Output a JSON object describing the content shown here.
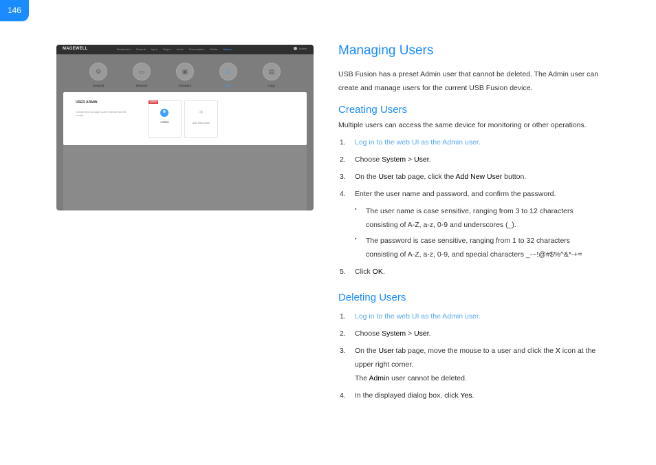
{
  "page_number": "146",
  "screenshot": {
    "logo": "MAGEWELL",
    "nav": [
      "Dashboard",
      "General",
      "Input",
      "Output",
      "Audio",
      "Presentation",
      "Media",
      "System"
    ],
    "nav_active": "System",
    "user_menu": "Admin",
    "tabs": [
      {
        "label": "General",
        "icon": "gear-icon"
      },
      {
        "label": "Network",
        "icon": "monitor-icon"
      },
      {
        "label": "Firmware",
        "icon": "chip-icon"
      },
      {
        "label": "User",
        "icon": "users-icon"
      },
      {
        "label": "Logs",
        "icon": "clipboard-icon"
      }
    ],
    "card_title": "USER ADMIN",
    "card_desc": "Create and manage users that are stored locally.",
    "user_tag": "Admin",
    "user_name": "Admin",
    "add_label": "Add New User"
  },
  "title": "Managing Users",
  "intro": "USB Fusion has a preset Admin user that cannot be deleted. The Admin user can create and manage users for the current USB Fusion device.",
  "creating": {
    "heading": "Creating Users",
    "intro": "Multiple users can access the same device for monitoring or other operations.",
    "step1": {
      "num": "1.",
      "link": "Log in to the web UI as the Admin user."
    },
    "step2": {
      "num": "2.",
      "a": "Choose ",
      "k1": "System",
      "b": " > ",
      "k2": "User",
      "c": "."
    },
    "step3": {
      "num": "3.",
      "a": "On the ",
      "k1": "User",
      "b": " tab page, click the ",
      "k2": "Add New User",
      "c": " button."
    },
    "step4": {
      "num": "4.",
      "text": "Enter the user name and password, and confirm the password."
    },
    "bullet1": "The user name is case sensitive, ranging from 3 to 12 characters consisting of A-Z, a-z, 0-9 and underscores (_).",
    "bullet2": "The password is case sensitive, ranging from 1 to 32 characters consisting of A-Z, a-z, 0-9, and special characters _-~!@#$%^&*-+=",
    "step5": {
      "num": "5.",
      "a": "Click ",
      "k1": "OK",
      "c": "."
    }
  },
  "deleting": {
    "heading": "Deleting Users",
    "step1": {
      "num": "1.",
      "link": "Log in to the web UI as the Admin user."
    },
    "step2": {
      "num": "2.",
      "a": "Choose ",
      "k1": "System",
      "b": " > ",
      "k2": "User",
      "c": "."
    },
    "step3": {
      "num": "3.",
      "a": "On the ",
      "k1": "User",
      "b": " tab page, move the mouse to a user and click the ",
      "k2": "X",
      "c": " icon at the upper right corner."
    },
    "step3_note": {
      "a": "The ",
      "k1": "Admin",
      "b": " user cannot be deleted."
    },
    "step4": {
      "num": "4.",
      "a": "In the displayed dialog box, click ",
      "k1": "Yes",
      "c": "."
    }
  }
}
